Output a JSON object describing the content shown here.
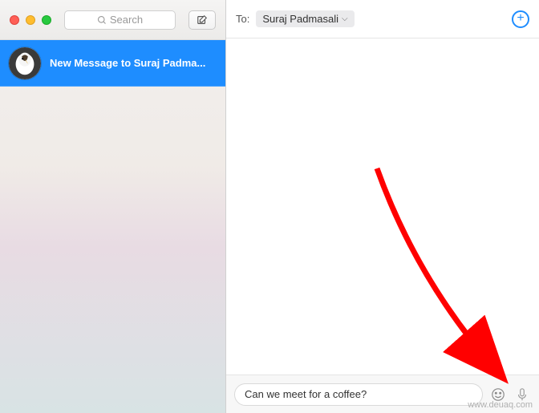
{
  "sidebar": {
    "search_placeholder": "Search",
    "conversation": {
      "title": "New Message to Suraj Padma..."
    }
  },
  "header": {
    "to_label": "To:",
    "recipient": "Suraj Padmasali"
  },
  "compose": {
    "message_value": "Can we meet for a coffee?"
  },
  "watermark": "www.deuaq.com"
}
